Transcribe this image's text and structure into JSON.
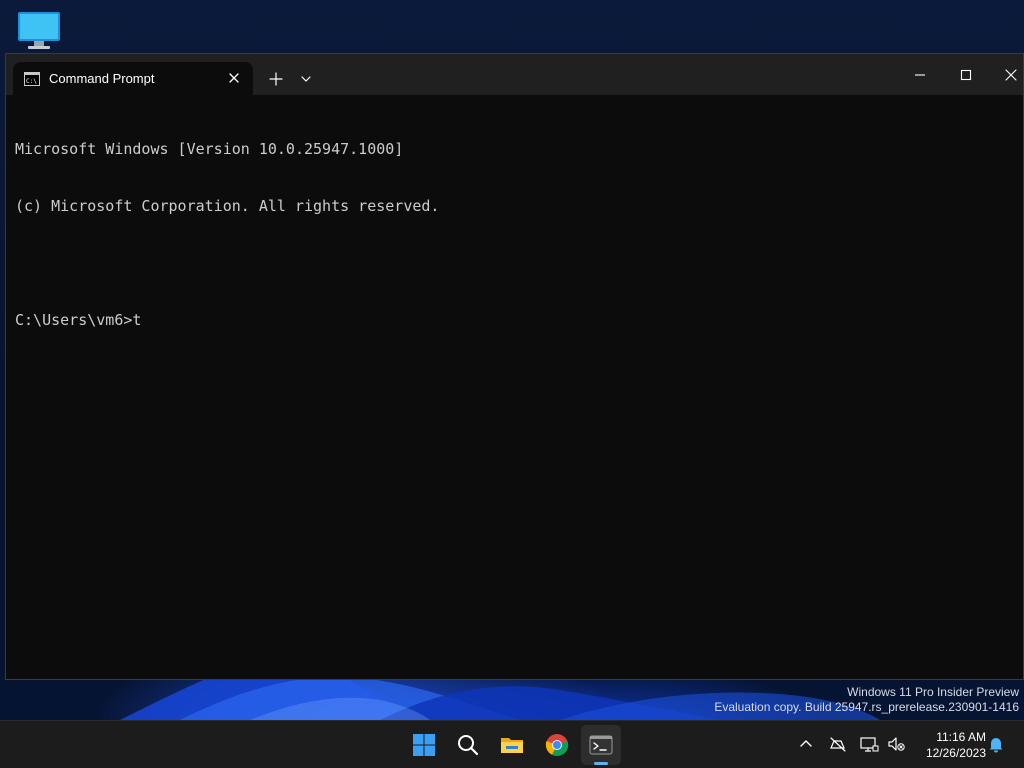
{
  "desktop": {
    "icon": "this-pc-monitor-icon",
    "watermark": {
      "line1": "Windows 11 Pro Insider Preview",
      "line2": "Evaluation copy. Build 25947.rs_prerelease.230901-1416"
    }
  },
  "window": {
    "tab": {
      "title": "Command Prompt",
      "icon": "cmd-icon"
    },
    "controls": [
      "minimize-icon",
      "maximize-icon",
      "close-icon"
    ],
    "console_lines": [
      "Microsoft Windows [Version 10.0.25947.1000]",
      "(c) Microsoft Corporation. All rights reserved.",
      "",
      "C:\\Users\\vm6>t"
    ]
  },
  "taskbar": {
    "apps": [
      "start-icon",
      "search-icon",
      "file-explorer-icon",
      "chrome-icon",
      "terminal-icon"
    ],
    "active_app": "terminal-icon",
    "tray": [
      "chevron-up-icon",
      "network-off-icon",
      "display-icon",
      "volume-muted-icon",
      "notification-bell-icon"
    ],
    "clock": {
      "time": "11:16 AM",
      "date": "12/26/2023"
    }
  },
  "colors": {
    "console_bg": "#0c0c0c",
    "console_text": "#cccccc",
    "titlebar_bg": "#202020",
    "taskbar_bg": "#1c1c1c",
    "accent": "#5fb2f2"
  }
}
